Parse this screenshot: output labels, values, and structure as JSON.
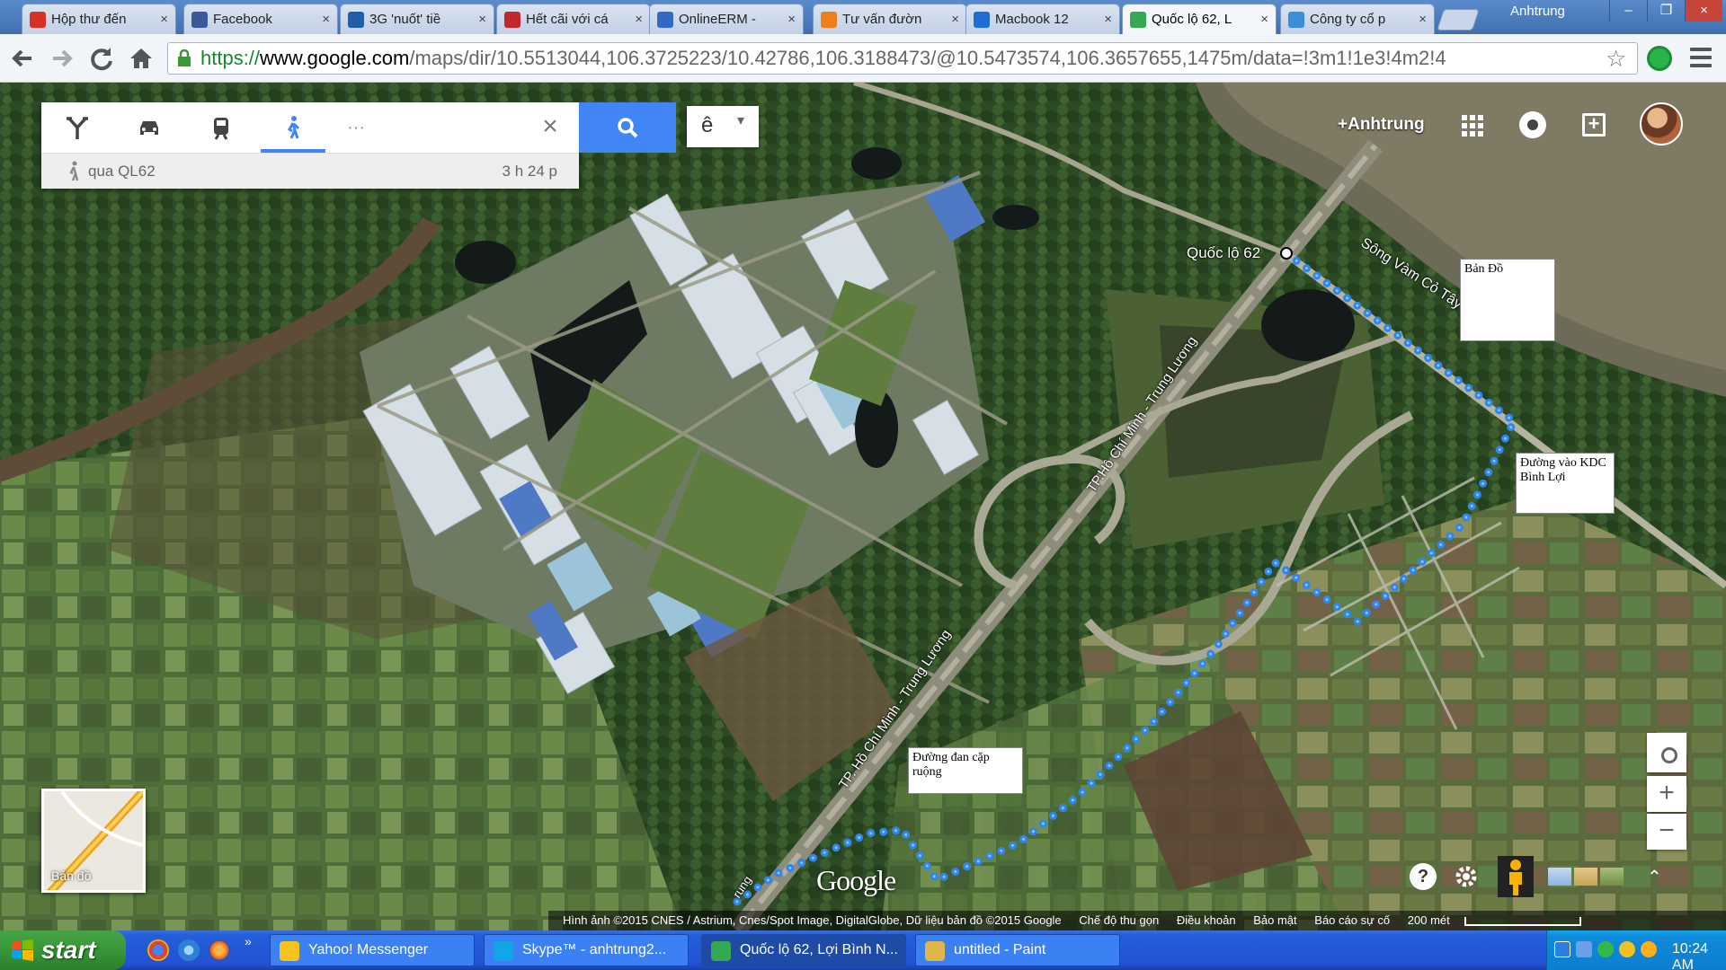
{
  "browser": {
    "tabs": [
      {
        "label": "Hộp thư đến",
        "color": "#d93025"
      },
      {
        "label": "Facebook",
        "color": "#3b5998"
      },
      {
        "label": "3G 'nuốt' tiề",
        "color": "#1f5fa8"
      },
      {
        "label": "Hết cãi với cá",
        "color": "#c1272d"
      },
      {
        "label": "OnlineERM -",
        "color": "#3369c4"
      },
      {
        "label": "Tư vấn đườn",
        "color": "#ef7f1a"
      },
      {
        "label": "Macbook 12",
        "color": "#1f6ed4"
      },
      {
        "label": "Quốc lộ 62, L",
        "color": "#34a853"
      },
      {
        "label": "Công ty cổ p",
        "color": "#3b8fd8"
      }
    ],
    "active_tab_index": 7,
    "tab_close_glyph": "×",
    "window_user": "Anhtrung",
    "window_controls": [
      "–",
      "❐",
      "×"
    ],
    "url": {
      "scheme": "https://",
      "host": "www.google.com",
      "rest": "/maps/dir/10.5513044,106.3725223/10.42786,106.3188473/@10.5473574,106.3657655,1475m/data=!3m1!1e3!4m2!4"
    },
    "star_glyph": "☆"
  },
  "map": {
    "directions": {
      "modes": [
        "directions-icon",
        "car-icon",
        "transit-icon",
        "walk-icon"
      ],
      "active_mode": "walk-icon",
      "more_glyph": "···",
      "close_glyph": "×",
      "route_name": "qua QL62",
      "route_time": "3 h 24 p"
    },
    "layer_button": {
      "label": "ê",
      "arrow": "▾"
    },
    "account": {
      "user": "+Anhtrung"
    },
    "labels": {
      "river": "Sông Vàm Cỏ Tây",
      "road_start": "Quốc lộ 62",
      "highway_upper": "TP.Hồ Chí Minh - Trung Lương",
      "highway_lower": "TP. Hồ Chí Minh - Trung Lương",
      "road_end": "rung"
    },
    "notes": {
      "ban_do": "Bản Đồ",
      "duong_vao": "Đường vào KDC Bình Lợi",
      "duong_dan": "Đường đan cặp ruộng"
    },
    "minimap_label": "Bản đồ",
    "google_logo": "Google",
    "zoom_in": "+",
    "zoom_out": "−",
    "help_glyph": "?",
    "expand_glyph": "⌃",
    "attribution": {
      "imagery": "Hình ảnh ©2015 CNES / Astrium, Cnes/Spot Image, DigitalGlobe, Dữ liệu bản đồ ©2015 Google",
      "links": [
        "Chế độ thu gọn",
        "Điều khoản",
        "Bảo mật",
        "Báo cáo sự cố"
      ],
      "scale": "200 mét"
    }
  },
  "taskbar": {
    "start_label": "start",
    "more_glyph": "»",
    "tasks": [
      {
        "label": "Yahoo! Messenger",
        "color": "#f6c21b"
      },
      {
        "label": "Skype™ - anhtrung2...",
        "color": "#12a5e8"
      },
      {
        "label": "Quốc lộ 62, Lợi Bình N...",
        "color": "#34a853"
      },
      {
        "label": "untitled - Paint",
        "color": "#e0b64a"
      }
    ],
    "active_task_index": 2,
    "clock": "10:24 AM"
  }
}
